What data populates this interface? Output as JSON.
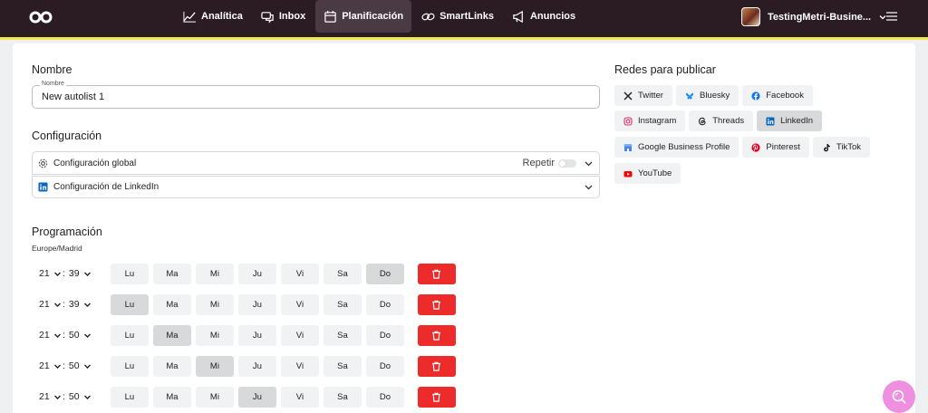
{
  "nav": {
    "items": [
      {
        "label": "Analítica",
        "icon": "chart-line-icon"
      },
      {
        "label": "Inbox",
        "icon": "chat-bubbles-icon"
      },
      {
        "label": "Planificación",
        "icon": "calendar-icon",
        "active": true
      },
      {
        "label": "SmartLinks",
        "icon": "link-icon"
      },
      {
        "label": "Anuncios",
        "icon": "megaphone-icon"
      }
    ],
    "account_name": "TestingMetri-Busine..."
  },
  "form": {
    "nombre_heading": "Nombre",
    "nombre_legend": "Nombre",
    "nombre_value": "New autolist 1",
    "config_heading": "Configuración",
    "config_global": "Configuración global",
    "repetir": "Repetir",
    "config_linkedin": "Configuración de LinkedIn",
    "prog_heading": "Programación",
    "timezone": "Europe/Madrid"
  },
  "schedule": [
    {
      "hour": "21",
      "minute": "39",
      "active_days": [
        "Do"
      ]
    },
    {
      "hour": "21",
      "minute": "39",
      "active_days": [
        "Lu"
      ]
    },
    {
      "hour": "21",
      "minute": "50",
      "active_days": [
        "Ma"
      ]
    },
    {
      "hour": "21",
      "minute": "50",
      "active_days": [
        "Mi"
      ]
    },
    {
      "hour": "21",
      "minute": "50",
      "active_days": [
        "Ju"
      ]
    }
  ],
  "days": [
    "Lu",
    "Ma",
    "Mi",
    "Ju",
    "Vi",
    "Sa",
    "Do"
  ],
  "networks": {
    "heading": "Redes para publicar",
    "rows": [
      [
        {
          "label": "Twitter",
          "icon": "x-icon",
          "color": "#222222"
        },
        {
          "label": "Bluesky",
          "icon": "bluesky-icon",
          "color": "#1185fe"
        },
        {
          "label": "Facebook",
          "icon": "facebook-icon",
          "color": "#1877f2"
        }
      ],
      [
        {
          "label": "Instagram",
          "icon": "instagram-icon",
          "color": "#e1306c"
        },
        {
          "label": "Threads",
          "icon": "threads-icon",
          "color": "#222222"
        },
        {
          "label": "LinkedIn",
          "icon": "linkedin-icon",
          "color": "#0a66c2",
          "selected": true
        }
      ],
      [
        {
          "label": "Google Business Profile",
          "icon": "google-business-icon",
          "color": "#4285f4"
        },
        {
          "label": "Pinterest",
          "icon": "pinterest-icon",
          "color": "#e60023"
        },
        {
          "label": "TikTok",
          "icon": "tiktok-icon",
          "color": "#111111"
        }
      ],
      [
        {
          "label": "YouTube",
          "icon": "youtube-icon",
          "color": "#ff0000"
        }
      ]
    ]
  },
  "colors": {
    "topbar": "#2b1c24",
    "accent_line": "#f2e94e",
    "delete": "#ee2b2b",
    "fab": "#ef8fe0"
  }
}
